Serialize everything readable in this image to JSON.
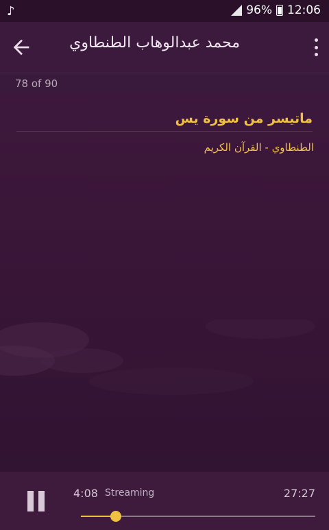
{
  "status_bar": {
    "battery_percent": "96%",
    "time": "12:06"
  },
  "toolbar": {
    "title": "محمد عبدالوهاب الطنطاوي"
  },
  "counter": {
    "text": "78 of 90"
  },
  "track": {
    "title": "ماتيسر من سورة يس",
    "subtitle": "الطنطاوي - القرآن الكريم"
  },
  "player": {
    "elapsed": "4:08",
    "status": "Streaming",
    "duration": "27:27",
    "progress_fraction": 0.15
  },
  "colors": {
    "accent": "#f0c040",
    "background": "#3a1639",
    "toolbar": "#3c1a3d"
  }
}
